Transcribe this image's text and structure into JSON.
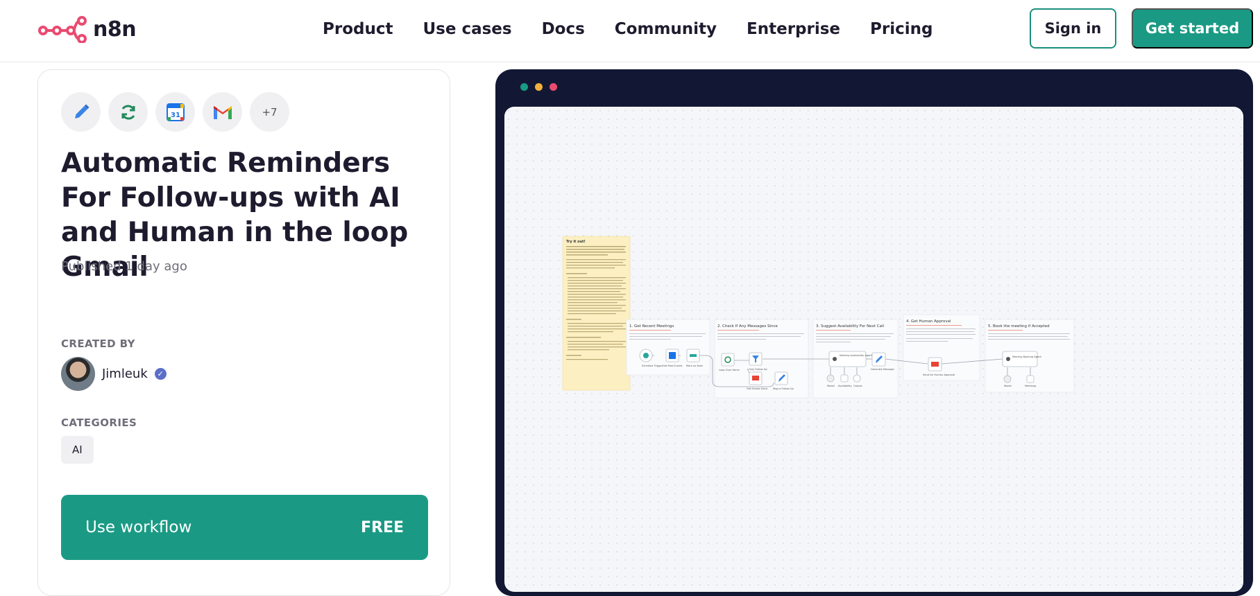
{
  "header": {
    "logo_text": "n8n",
    "nav": [
      "Product",
      "Use cases",
      "Docs",
      "Community",
      "Enterprise",
      "Pricing"
    ],
    "sign_in": "Sign in",
    "get_started": "Get started",
    "accent": "#1a9a84",
    "logo_color": "#ea4b71"
  },
  "template": {
    "app_icons": [
      "pencil-icon",
      "refresh-icon",
      "google-calendar-icon",
      "gmail-icon"
    ],
    "more_count": "+7",
    "title": "Automatic Reminders For Follow-ups with AI and Human in the loop Gmail",
    "published": "Published 1 day ago",
    "created_by_label": "CREATED BY",
    "creator": "Jimleuk",
    "categories_label": "CATEGORIES",
    "category": "AI",
    "use_workflow": "Use workflow",
    "price": "FREE"
  },
  "workflow": {
    "note_title": "Try it out!",
    "sections": [
      "1. Get Recent Meetings",
      "2. Check If Any Messages Since",
      "3. Suggest Availability For Next Call",
      "4. Get Human Approval",
      "5. Book the meeting if Accepted"
    ],
    "nodes": {
      "schedule": "Schedule Trigger",
      "get_past": "Get Past Events",
      "mark": "Mark as Seen",
      "loop": "Loop Over Items",
      "only_follow": "Only Follow Up",
      "get_emails": "Get Emails Since",
      "msg_follow": "Msg is Follow Up",
      "agent": "Meeting Availability Agent",
      "generate": "Generate Message",
      "send": "Send for Human Approval",
      "booking": "Meeting Booking Agent",
      "model1": "Model",
      "availability": "Availability",
      "output": "Output",
      "model2": "Model",
      "meetings": "Meetings"
    }
  }
}
